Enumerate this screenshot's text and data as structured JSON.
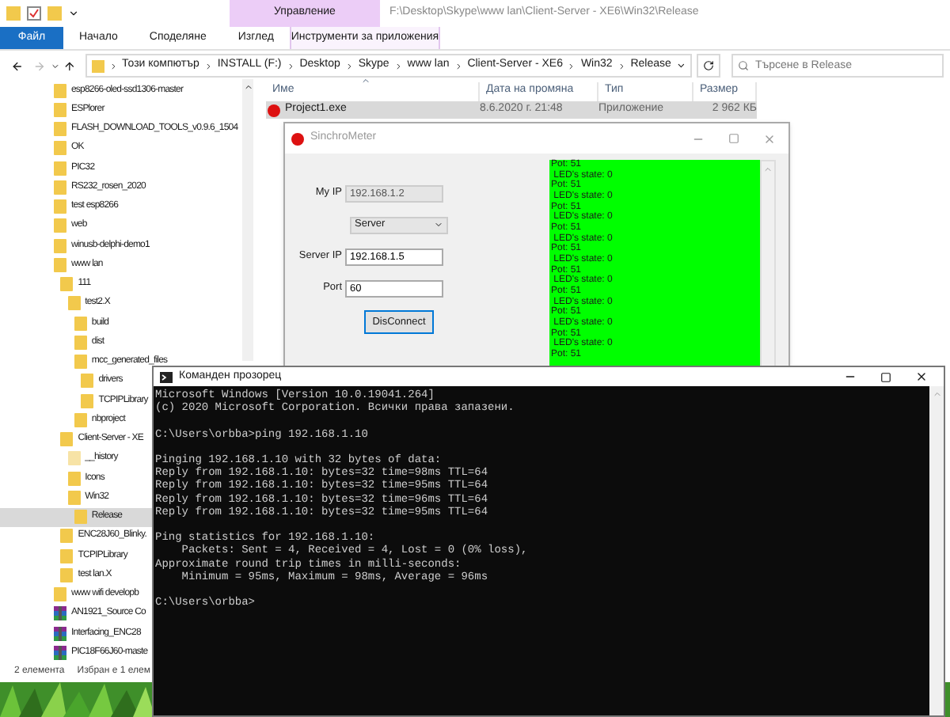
{
  "explorer": {
    "context_group": "Управление",
    "title": "F:\\Desktop\\Skype\\www lan\\Client-Server - XE6\\Win32\\Release",
    "ribbon_tabs": [
      {
        "label": "Файл",
        "kind": "file"
      },
      {
        "label": "Начало",
        "kind": "tab"
      },
      {
        "label": "Споделяне",
        "kind": "tab"
      },
      {
        "label": "Изглед",
        "kind": "tab"
      },
      {
        "label": "Инструменти за приложения",
        "kind": "context"
      }
    ],
    "breadcrumb": [
      "Този компютър",
      "INSTALL (F:)",
      "Desktop",
      "Skype",
      "www lan",
      "Client-Server - XE6",
      "Win32",
      "Release"
    ],
    "search": {
      "placeholder": "Търсене в Release"
    },
    "tree": [
      {
        "label": "esp8266-oled-ssd1306-master",
        "kind": "folder",
        "selected": false
      },
      {
        "label": "ESPlorer",
        "kind": "folder",
        "selected": false
      },
      {
        "label": "FLASH_DOWNLOAD_TOOLS_v0.9.6_1504",
        "kind": "folder",
        "selected": false
      },
      {
        "label": "OK",
        "kind": "folder",
        "selected": false
      },
      {
        "label": "PIC32",
        "kind": "folder",
        "selected": false
      },
      {
        "label": "RS232_rosen_2020",
        "kind": "folder",
        "selected": false
      },
      {
        "label": "test esp8266",
        "kind": "folder",
        "selected": false
      },
      {
        "label": "web",
        "kind": "folder",
        "selected": false
      },
      {
        "label": "winusb-delphi-demo1",
        "kind": "folder",
        "selected": false
      },
      {
        "label": "www lan",
        "kind": "folder",
        "selected": false,
        "children": [
          {
            "label": "111",
            "kind": "folder",
            "selected": false,
            "children": [
              {
                "label": "test2.X",
                "kind": "folder",
                "selected": false,
                "children": [
                  {
                    "label": "build",
                    "kind": "folder",
                    "selected": false
                  },
                  {
                    "label": "dist",
                    "kind": "folder",
                    "selected": false
                  },
                  {
                    "label": "mcc_generated_files",
                    "kind": "folder",
                    "selected": false,
                    "children": [
                      {
                        "label": "drivers",
                        "kind": "folder",
                        "selected": false
                      },
                      {
                        "label": "TCPIPLibrary",
                        "kind": "folder",
                        "selected": false
                      }
                    ]
                  },
                  {
                    "label": "nbproject",
                    "kind": "folder",
                    "selected": false
                  }
                ]
              }
            ]
          },
          {
            "label": "Client-Server - XE",
            "kind": "folder",
            "selected": false,
            "children": [
              {
                "label": "__history",
                "kind": "hidden_folder",
                "selected": false
              },
              {
                "label": "Icons",
                "kind": "folder",
                "selected": false
              },
              {
                "label": "Win32",
                "kind": "folder",
                "selected": false,
                "children": [
                  {
                    "label": "Release",
                    "kind": "folder",
                    "selected": true
                  }
                ]
              }
            ]
          },
          {
            "label": "ENC28J60_Blinky.",
            "kind": "folder",
            "selected": false
          },
          {
            "label": "TCPIPLibrary",
            "kind": "folder",
            "selected": false
          },
          {
            "label": "test lan.X",
            "kind": "folder",
            "selected": false
          }
        ]
      },
      {
        "label": "www wifi developb",
        "kind": "folder",
        "selected": false
      },
      {
        "label": "AN1921_Source Co",
        "kind": "archive",
        "selected": false
      },
      {
        "label": "Interfacing_ENC28",
        "kind": "archive",
        "selected": false
      },
      {
        "label": "PIC18F66J60-maste",
        "kind": "archive",
        "selected": false
      }
    ],
    "columns": [
      "Име",
      "Дата на промяна",
      "Тип",
      "Размер"
    ],
    "files": [
      {
        "name": "Project1.exe",
        "modified": "8.6.2020 г. 21:48",
        "type": "Приложение",
        "size": "2 962 КБ",
        "selected": true
      }
    ],
    "status_bar": {
      "count": "2 елемента",
      "selection": "Избран е 1 елем"
    }
  },
  "synchrometer": {
    "title": "SinchroMeter",
    "form": [
      {
        "kind": "field",
        "label": "My IP",
        "value": "192.168.1.2",
        "disabled": true
      },
      {
        "kind": "select",
        "value": "Server"
      },
      {
        "kind": "field",
        "label": "Server IP",
        "value": "192.168.1.5",
        "disabled": false
      },
      {
        "kind": "field",
        "label": "Port",
        "value": "60",
        "disabled": false
      }
    ],
    "button": "DisConnect",
    "log": [
      "Pot: 51",
      " LED's state: 0",
      "Pot: 51",
      " LED's state: 0",
      "Pot: 51",
      " LED's state: 0",
      "Pot: 51",
      " LED's state: 0",
      "Pot: 51",
      " LED's state: 0",
      "Pot: 51",
      " LED's state: 0",
      "Pot: 51",
      " LED's state: 0",
      "Pot: 51",
      " LED's state: 0",
      "Pot: 51",
      " LED's state: 0",
      "Pot: 51"
    ]
  },
  "console": {
    "title": "Команден прозорец",
    "blocks": [
      [
        "Microsoft Windows [Version 10.0.19041.264]",
        "(c) 2020 Microsoft Corporation. Всички права запазени."
      ],
      [
        "C:\\Users\\orbba>ping 192.168.1.10"
      ],
      [
        "Pinging 192.168.1.10 with 32 bytes of data:",
        "Reply from 192.168.1.10: bytes=32 time=98ms TTL=64",
        "Reply from 192.168.1.10: bytes=32 time=95ms TTL=64",
        "Reply from 192.168.1.10: bytes=32 time=96ms TTL=64",
        "Reply from 192.168.1.10: bytes=32 time=95ms TTL=64"
      ],
      [
        "Ping statistics for 192.168.1.10:",
        "    Packets: Sent = 4, Received = 4, Lost = 0 (0% loss),",
        "Approximate round trip times in milli-seconds:",
        "    Minimum = 95ms, Maximum = 98ms, Average = 96ms"
      ],
      [
        "C:\\Users\\orbba>"
      ]
    ]
  }
}
